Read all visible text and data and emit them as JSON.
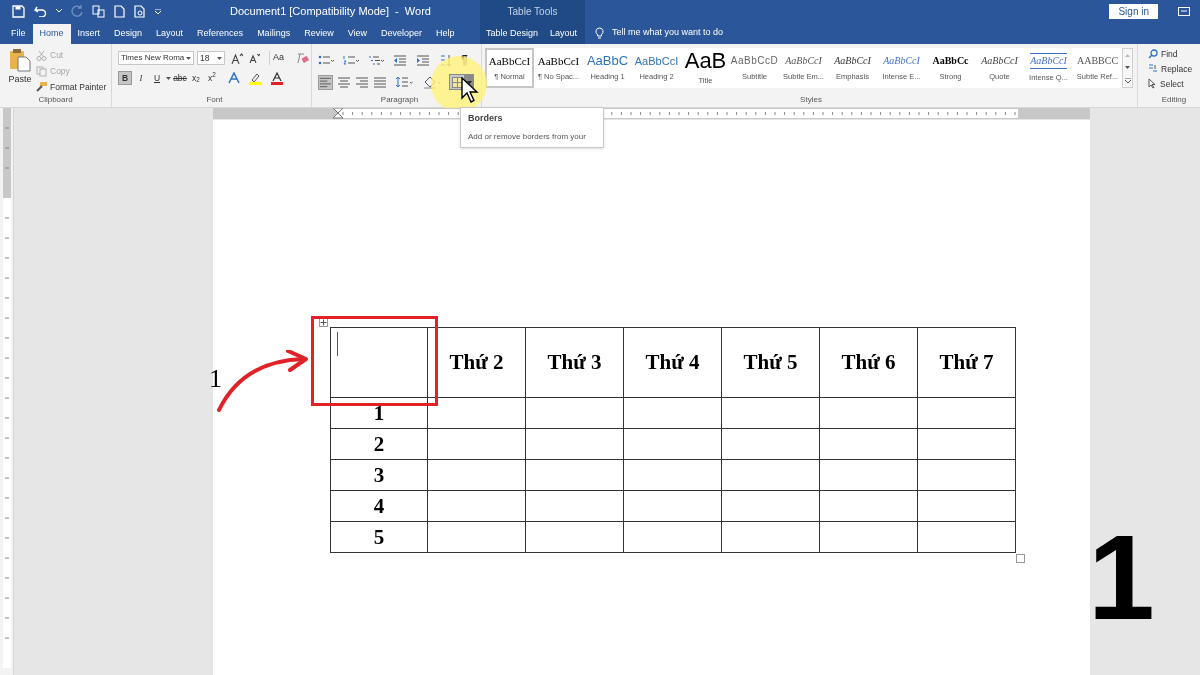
{
  "window": {
    "title": "Document1 [Compatibility Mode]  -  Word",
    "contextual_label": "Table Tools",
    "sign_in": "Sign in"
  },
  "tabs": [
    {
      "label": "File",
      "selected": false
    },
    {
      "label": "Home",
      "selected": true
    },
    {
      "label": "Insert",
      "selected": false
    },
    {
      "label": "Design",
      "selected": false
    },
    {
      "label": "Layout",
      "selected": false
    },
    {
      "label": "References",
      "selected": false
    },
    {
      "label": "Mailings",
      "selected": false
    },
    {
      "label": "Review",
      "selected": false
    },
    {
      "label": "View",
      "selected": false
    },
    {
      "label": "Developer",
      "selected": false
    },
    {
      "label": "Help",
      "selected": false
    }
  ],
  "contextual_tabs": [
    {
      "label": "Table Design",
      "selected": false
    },
    {
      "label": "Layout",
      "selected": false
    }
  ],
  "tell_me": "Tell me what you want to do",
  "clipboard": {
    "label": "Clipboard",
    "paste": "Paste",
    "items": [
      {
        "label": "Cut",
        "disabled": true
      },
      {
        "label": "Copy",
        "disabled": true
      },
      {
        "label": "Format Painter",
        "disabled": false
      }
    ]
  },
  "font": {
    "label": "Font",
    "name": "Times New Roma",
    "size": "18",
    "case_button": "Aa",
    "format_buttons": [
      {
        "label": "B",
        "selected": true
      },
      {
        "label": "I",
        "selected": false
      },
      {
        "label": "U",
        "selected": false
      },
      {
        "label": "abc",
        "selected": false
      },
      {
        "label": "x$_{2}$",
        "selected": false
      },
      {
        "label": "x$^{2}$",
        "selected": false
      }
    ]
  },
  "paragraph": {
    "label": "Paragraph",
    "pilcrow": "¶",
    "alignment": [
      {
        "selected": true
      },
      {
        "selected": false
      },
      {
        "selected": false
      },
      {
        "selected": false
      }
    ],
    "borders_selected": true
  },
  "styles": {
    "label": "Styles",
    "items": [
      {
        "preview": "AaBbCcI",
        "name": "¶ Normal",
        "selected": true
      },
      {
        "preview": "AaBbCcI",
        "name": "¶ No Spac...",
        "selected": false
      },
      {
        "preview": "AaBbC",
        "name": "Heading 1",
        "selected": false
      },
      {
        "preview": "AaBbCcI",
        "name": "Heading 2",
        "selected": false
      },
      {
        "preview": "AaB",
        "name": "Title",
        "selected": false
      },
      {
        "preview": "AaBbCcD",
        "name": "Subtitle",
        "selected": false
      },
      {
        "preview": "AaBbCcI",
        "name": "Subtle Em...",
        "selected": false
      },
      {
        "preview": "AaBbCcI",
        "name": "Emphasis",
        "selected": false
      },
      {
        "preview": "AaBbCcI",
        "name": "Intense E...",
        "selected": false
      },
      {
        "preview": "AaBbCc",
        "name": "Strong",
        "selected": false
      },
      {
        "preview": "AaBbCcI",
        "name": "Quote",
        "selected": false
      },
      {
        "preview": "AaBbCcI",
        "name": "Intense Q...",
        "selected": false
      },
      {
        "preview": "AABBCC",
        "name": "Subtle Ref...",
        "selected": false
      }
    ]
  },
  "editing": {
    "label": "Editing",
    "items": [
      "Find",
      "Replace",
      "Select"
    ]
  },
  "tooltip": {
    "title": "Borders",
    "text": "Add or remove borders from your"
  },
  "table": {
    "columns": [
      "",
      "Thứ 2",
      "Thứ 3",
      "Thứ 4",
      "Thứ 5",
      "Thứ 6",
      "Thứ 7"
    ],
    "rows": [
      [
        "1",
        "",
        "",
        "",
        "",
        "",
        ""
      ],
      [
        "2",
        "",
        "",
        "",
        "",
        "",
        ""
      ],
      [
        "3",
        "",
        "",
        "",
        "",
        "",
        ""
      ],
      [
        "4",
        "",
        "",
        "",
        "",
        "",
        ""
      ],
      [
        "5",
        "",
        "",
        "",
        "",
        "",
        ""
      ]
    ]
  },
  "annotations": {
    "step_label": "1",
    "corner_number": "1"
  }
}
